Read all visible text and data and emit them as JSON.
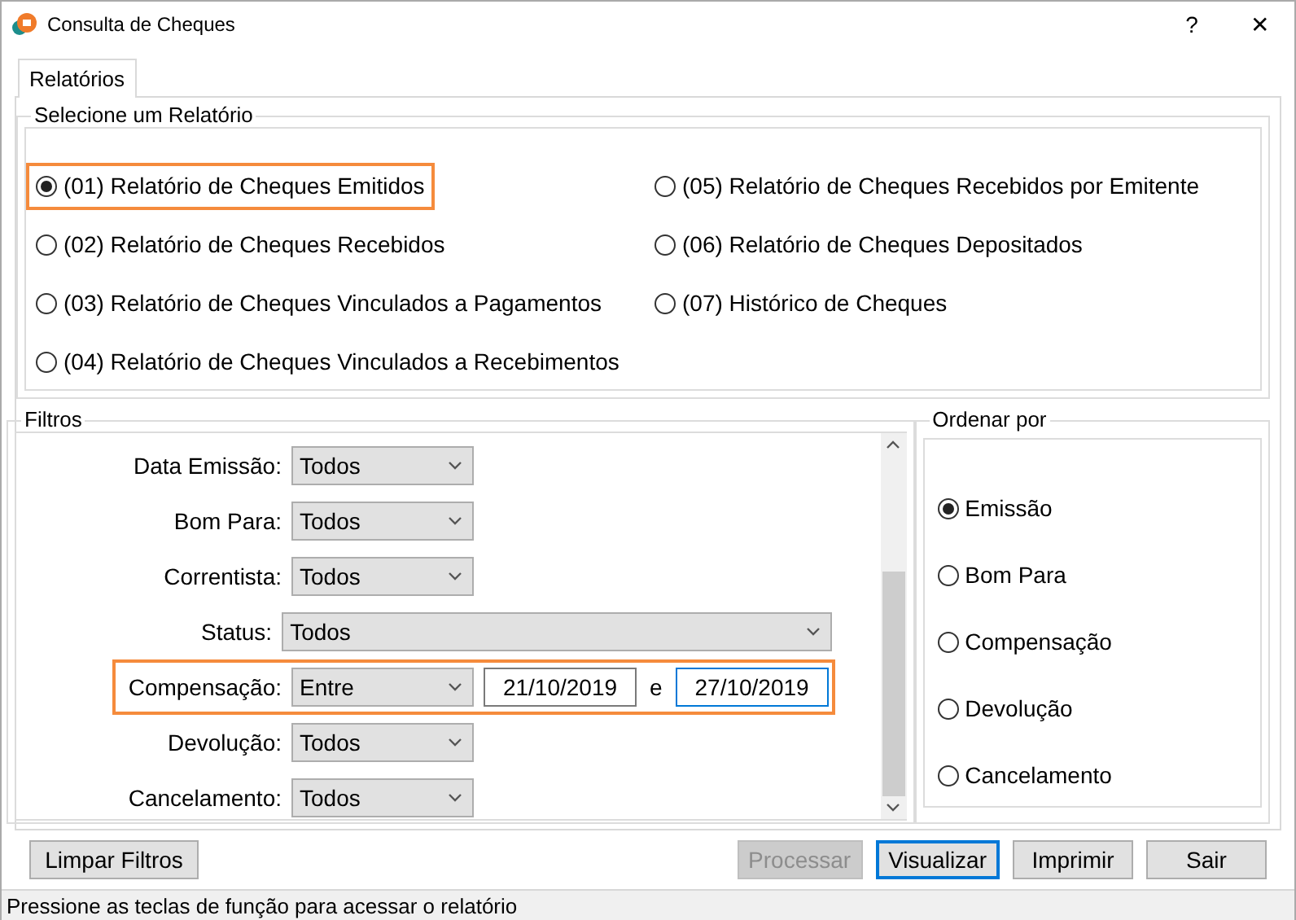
{
  "window": {
    "title": "Consulta de Cheques",
    "help": "?",
    "close": "✕"
  },
  "tabs": [
    {
      "label": "Relatórios",
      "selected": true
    }
  ],
  "report_group": {
    "title": "Selecione um Relatório",
    "options": [
      {
        "label": "(01) Relatório de Cheques Emitidos",
        "selected": true,
        "highlighted": true
      },
      {
        "label": "(02) Relatório de Cheques Recebidos",
        "selected": false,
        "highlighted": false
      },
      {
        "label": "(03) Relatório de Cheques Vinculados a Pagamentos",
        "selected": false,
        "highlighted": false
      },
      {
        "label": "(04) Relatório de Cheques Vinculados a Recebimentos",
        "selected": false,
        "highlighted": false
      },
      {
        "label": "(05) Relatório de Cheques Recebidos por Emitente",
        "selected": false,
        "highlighted": false
      },
      {
        "label": "(06) Relatório de Cheques Depositados",
        "selected": false,
        "highlighted": false
      },
      {
        "label": "(07) Histórico de Cheques",
        "selected": false,
        "highlighted": false
      }
    ]
  },
  "filters": {
    "title": "Filtros",
    "rows": [
      {
        "kind": "short",
        "label": "Data Emissão:",
        "value": "Todos",
        "highlighted": false
      },
      {
        "kind": "short",
        "label": "Bom Para:",
        "value": "Todos",
        "highlighted": false
      },
      {
        "kind": "short",
        "label": "Correntista:",
        "value": "Todos",
        "highlighted": false
      },
      {
        "kind": "wide",
        "label": "Status:",
        "value": "Todos",
        "highlighted": false
      },
      {
        "kind": "range",
        "label": "Compensação:",
        "value": "Entre",
        "from": "21/10/2019",
        "joiner": "e",
        "to": "27/10/2019",
        "highlighted": true
      },
      {
        "kind": "short",
        "label": "Devolução:",
        "value": "Todos",
        "highlighted": false
      },
      {
        "kind": "short",
        "label": "Cancelamento:",
        "value": "Todos",
        "highlighted": false
      }
    ]
  },
  "order_group": {
    "title": "Ordenar por",
    "options": [
      {
        "label": "Emissão",
        "selected": true
      },
      {
        "label": "Bom Para",
        "selected": false
      },
      {
        "label": "Compensação",
        "selected": false
      },
      {
        "label": "Devolução",
        "selected": false
      },
      {
        "label": "Cancelamento",
        "selected": false
      }
    ]
  },
  "buttons": [
    {
      "label": "Limpar Filtros",
      "disabled": false,
      "focused": false,
      "kind": "clear"
    },
    {
      "label": "Processar",
      "disabled": true,
      "focused": false,
      "kind": "action"
    },
    {
      "label": "Visualizar",
      "disabled": false,
      "focused": true,
      "kind": "action"
    },
    {
      "label": "Imprimir",
      "disabled": false,
      "focused": false,
      "kind": "action"
    },
    {
      "label": "Sair",
      "disabled": false,
      "focused": false,
      "kind": "action"
    }
  ],
  "status_bar": "Pressione as teclas de função para acessar o relatório"
}
